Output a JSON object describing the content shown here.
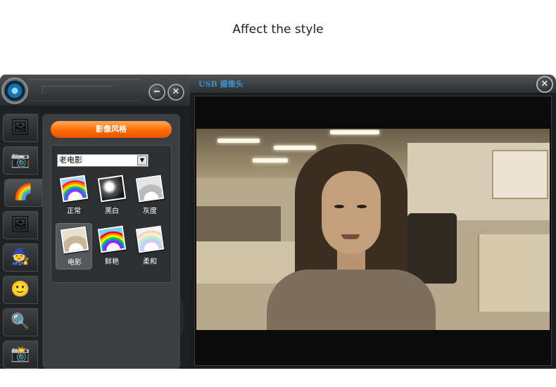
{
  "caption": "Affect the style",
  "left_window": {
    "minimize_label": "−",
    "close_label": "✕",
    "tabs": [
      {
        "name": "image-tab",
        "icon": "🖼"
      },
      {
        "name": "camera-tab",
        "icon": "📷"
      },
      {
        "name": "style-tab",
        "icon": "🌈"
      },
      {
        "name": "frame-tab",
        "icon": "🖼"
      },
      {
        "name": "magic-tab",
        "icon": "🧙"
      },
      {
        "name": "face-tab",
        "icon": "🙂"
      },
      {
        "name": "search-tab",
        "icon": "🔍"
      },
      {
        "name": "capture-tab",
        "icon": "📸"
      }
    ],
    "style_panel": {
      "header": "影像风格",
      "select_value": "老电影",
      "select_arrow": "▼",
      "effects": [
        {
          "label": "正常"
        },
        {
          "label": "黑白"
        },
        {
          "label": "灰度"
        },
        {
          "label": "电影"
        },
        {
          "label": "鲜艳"
        },
        {
          "label": "柔和"
        }
      ],
      "selected_effect": "电影"
    }
  },
  "video_window": {
    "title": "USB 摄像头",
    "close_label": "✕"
  },
  "colors": {
    "accent_orange": "#ff6a00",
    "title_blue": "#3f8fc9",
    "panel_dark": "#1c1e1f"
  }
}
